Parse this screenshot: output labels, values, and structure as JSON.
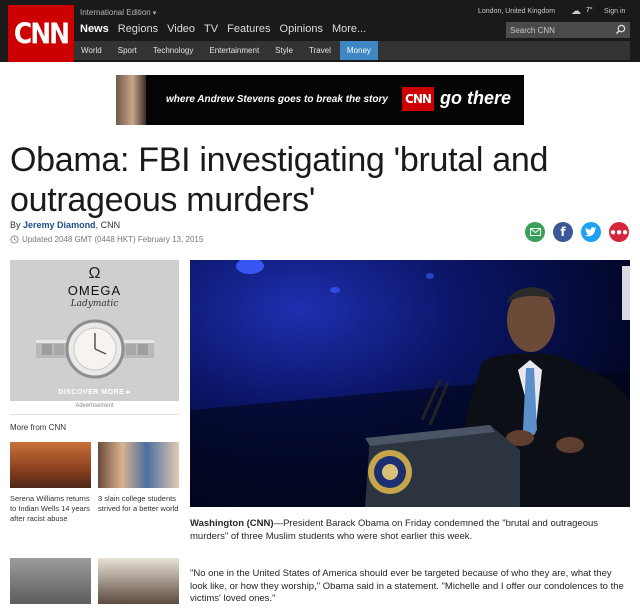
{
  "header": {
    "logo": "CNN",
    "edition_label": "International Edition",
    "main_nav": [
      "News",
      "Regions",
      "Video",
      "TV",
      "Features",
      "Opinions",
      "More..."
    ],
    "sub_nav": [
      "World",
      "Sport",
      "Technology",
      "Entertainment",
      "Style",
      "Travel",
      "Money"
    ],
    "location": "London, United Kingdom",
    "temperature": "7°",
    "sign_in": "Sign in",
    "search_placeholder": "Search CNN"
  },
  "banner": {
    "tagline": "where Andrew Stevens goes to break the story",
    "logo": "CNN",
    "slogan": "go there"
  },
  "article": {
    "headline": "Obama: FBI investigating 'brutal and outrageous murders'",
    "by_prefix": "By",
    "author": "Jeremy Diamond",
    "author_suffix": ", CNN",
    "updated": "Updated 2048 GMT (0448 HKT) February 13, 2015",
    "dateline": "Washington (CNN)",
    "lede": "—President Barack Obama on Friday condemned the \"brutal and outrageous murders\" of three Muslim students who were shot earlier this week.",
    "para2": "\"No one in the United States of America should ever be targeted because of who they are, what they look like, or how they worship,\" Obama said in a statement. \"Michelle and I offer our condolences to the victims' loved ones.\""
  },
  "share": [
    "email-icon",
    "facebook-icon",
    "twitter-icon",
    "more-icon"
  ],
  "sidebar": {
    "ad": {
      "brand_symbol": "Ω",
      "brand": "OMEGA",
      "collection": "Ladymatic",
      "cta": "DISCOVER MORE ▸",
      "label": "Advertisement"
    },
    "more_from_title": "More from CNN",
    "stories": [
      {
        "text": "Serena Williams returns to Indian Wells 14 years after racist abuse"
      },
      {
        "text": "3 slain college students strived for a better world"
      }
    ]
  },
  "colors": {
    "cnn_red": "#cc0000",
    "header_bg": "#1a1a1a",
    "active_tab": "#3f86c4",
    "author_link": "#1c4f8a"
  }
}
